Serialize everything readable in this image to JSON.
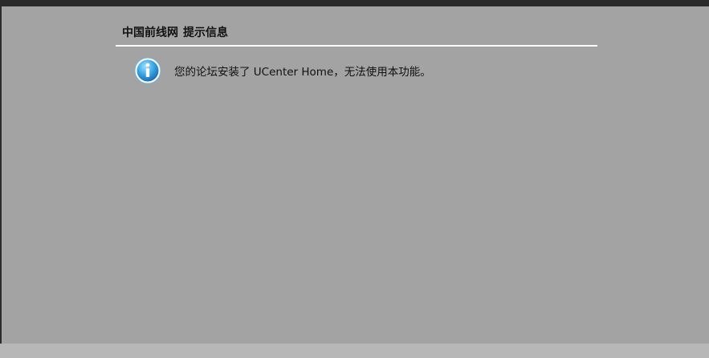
{
  "dialog": {
    "site_name": "中国前线网",
    "title": "提示信息",
    "message": "您的论坛安装了 UCenter Home，无法使用本功能。"
  },
  "icons": {
    "info": "info-icon"
  },
  "colors": {
    "overlay_background": "#a3a3a3",
    "top_bar": "#2a2a2a",
    "title_divider": "#ffffff",
    "icon_blue": "#3aa0dc"
  }
}
